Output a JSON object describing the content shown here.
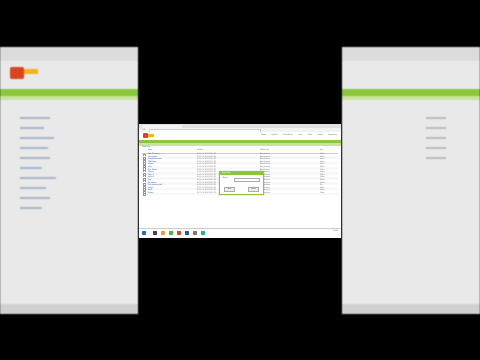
{
  "app": {
    "title": "Alfresco - Document Library",
    "address": "localhost:8080/share/page/repository"
  },
  "header": {
    "nav": [
      "Home",
      "My Files",
      "Shared Files",
      "Sites",
      "Tasks",
      "People",
      "Repository"
    ]
  },
  "breadcrumb": "Repository",
  "table": {
    "columns": [
      "Name",
      "Modified",
      "Modified By",
      "Type"
    ],
    "rows": [
      [
        "Data Dictionary",
        "Fri 10 Oct 2014 10:12:58",
        "Administrator",
        "Folder"
      ],
      [
        "Guest Home",
        "Fri 10 Oct 2014 10:12:58",
        "Administrator",
        "Folder"
      ],
      [
        "Imap Attachments",
        "Fri 10 Oct 2014 10:12:58",
        "Administrator",
        "Folder"
      ],
      [
        "IMAP Home",
        "Fri 10 Oct 2014 10:12:58",
        "Administrator",
        "Folder"
      ],
      [
        "Shared",
        "Fri 10 Oct 2014 10:12:58",
        "Administrator",
        "Folder"
      ],
      [
        "Sites",
        "Fri 10 Oct 2014 10:12:58",
        "Administrator",
        "Folder"
      ],
      [
        "User Homes",
        "Fri 10 Oct 2014 10:12:58",
        "Administrator",
        "Folder"
      ],
      [
        "Folder 1",
        "Fri 10 Oct 2014 10:12:58",
        "Administrator",
        "Folder"
      ],
      [
        "Folder 2",
        "Fri 10 Oct 2014 10:12:58",
        "Administrator",
        "Folder"
      ],
      [
        "Folder 3",
        "Fri 10 Oct 2014 10:12:58",
        "Administrator",
        "Folder"
      ],
      [
        "Test",
        "Fri 10 Oct 2014 10:12:58",
        "Administrator",
        "Folder"
      ],
      [
        "Documents",
        "Fri 10 Oct 2014 10:12:58",
        "Administrator",
        "Folder"
      ],
      [
        "Test document.pdf",
        "Fri 10 Oct 2014 10:12:58",
        "Administrator",
        "File"
      ],
      [
        "Images",
        "Fri 10 Oct 2014 10:12:58",
        "Administrator",
        "Folder"
      ],
      [
        "Notes",
        "Fri 10 Oct 2014 10:12:58",
        "Administrator",
        "Folder"
      ],
      [
        "Reports",
        "Fri 10 Oct 2014 10:12:58",
        "Administrator",
        "Folder"
      ]
    ]
  },
  "dialog": {
    "title": "New Folder",
    "label": "Name",
    "ok": "Save",
    "cancel": "Cancel"
  },
  "taskbar": {
    "time": "10:13"
  },
  "colors": {
    "accent": "#8cc63f",
    "logo": "#d8461f"
  }
}
